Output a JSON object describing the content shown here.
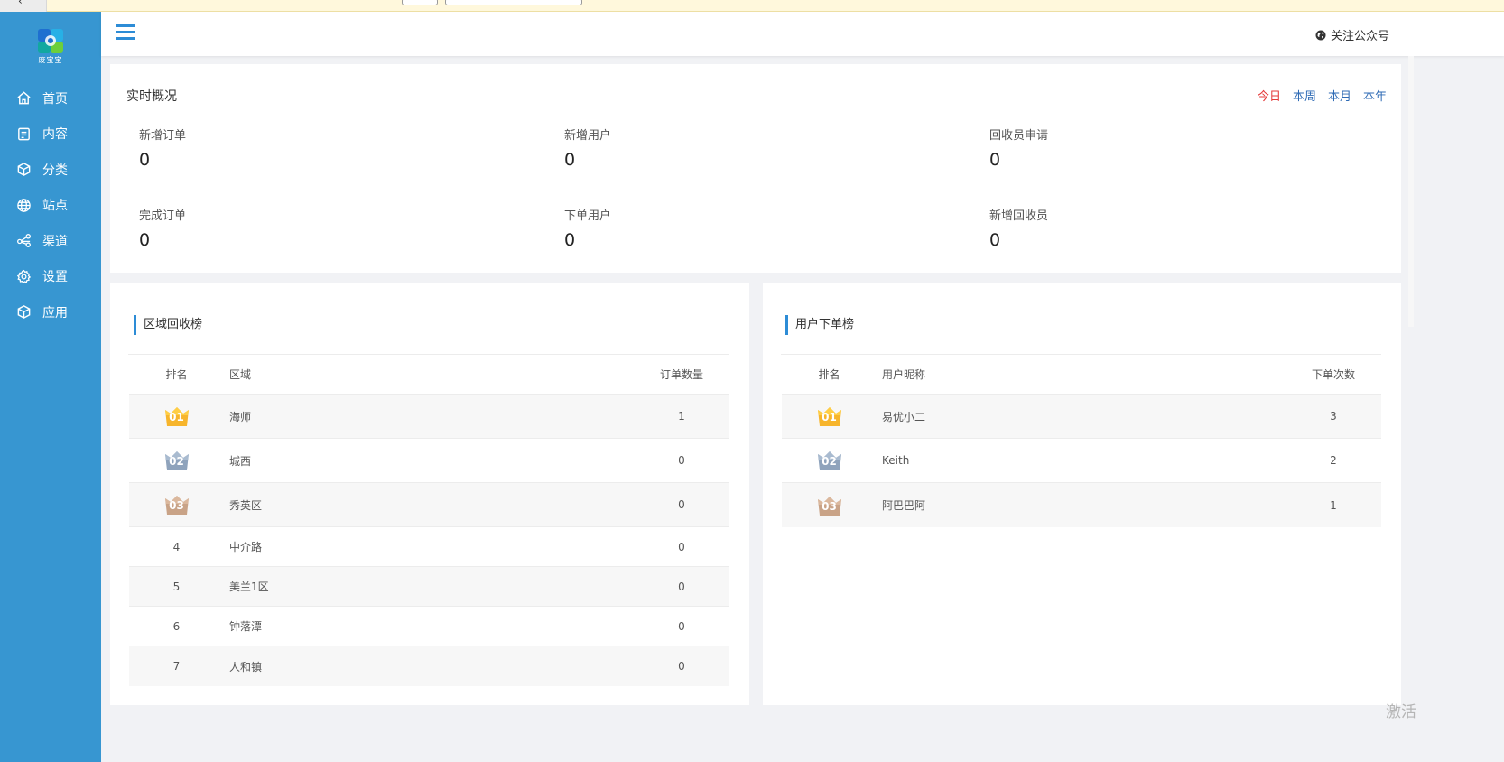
{
  "topbar": {},
  "brand": {
    "logo_text": "废宝宝"
  },
  "sidebar": {
    "items": [
      {
        "label": "首页",
        "icon": "home-icon"
      },
      {
        "label": "内容",
        "icon": "document-icon"
      },
      {
        "label": "分类",
        "icon": "cube-icon"
      },
      {
        "label": "站点",
        "icon": "globe-icon"
      },
      {
        "label": "渠道",
        "icon": "share-icon"
      },
      {
        "label": "设置",
        "icon": "gear-icon"
      },
      {
        "label": "应用",
        "icon": "cube-icon"
      }
    ]
  },
  "header": {
    "follow_label": "关注公众号",
    "follow_icon": "globe-icon"
  },
  "overview": {
    "title": "实时概况",
    "periods": [
      {
        "label": "今日",
        "active": true
      },
      {
        "label": "本周",
        "active": false
      },
      {
        "label": "本月",
        "active": false
      },
      {
        "label": "本年",
        "active": false
      }
    ],
    "stats": [
      {
        "label": "新增订单",
        "value": "0"
      },
      {
        "label": "新增用户",
        "value": "0"
      },
      {
        "label": "回收员申请",
        "value": "0"
      },
      {
        "label": "完成订单",
        "value": "0"
      },
      {
        "label": "下单用户",
        "value": "0"
      },
      {
        "label": "新增回收员",
        "value": "0"
      }
    ]
  },
  "region_rank": {
    "title": "区域回收榜",
    "columns": [
      "排名",
      "区域",
      "订单数量"
    ],
    "rows": [
      {
        "rank": "01",
        "name": "海师",
        "count": "1"
      },
      {
        "rank": "02",
        "name": "城西",
        "count": "0"
      },
      {
        "rank": "03",
        "name": "秀英区",
        "count": "0"
      },
      {
        "rank": "4",
        "name": "中介路",
        "count": "0"
      },
      {
        "rank": "5",
        "name": "美兰1区",
        "count": "0"
      },
      {
        "rank": "6",
        "name": "钟落潭",
        "count": "0"
      },
      {
        "rank": "7",
        "name": "人和镇",
        "count": "0"
      }
    ]
  },
  "user_rank": {
    "title": "用户下单榜",
    "columns": [
      "排名",
      "用户昵称",
      "下单次数"
    ],
    "rows": [
      {
        "rank": "01",
        "name": "易优小二",
        "count": "3"
      },
      {
        "rank": "02",
        "name": "Keith",
        "count": "2"
      },
      {
        "rank": "03",
        "name": "阿巴巴阿",
        "count": "1"
      }
    ]
  },
  "colors": {
    "sidebar": "#3796d1",
    "accent": "#2d8cd6",
    "active_period": "#e43a3a",
    "period": "#2f6bb5",
    "gold": "#f7b52c",
    "silver": "#8fa3bc",
    "bronze": "#c9a387"
  },
  "watermark": "激活"
}
